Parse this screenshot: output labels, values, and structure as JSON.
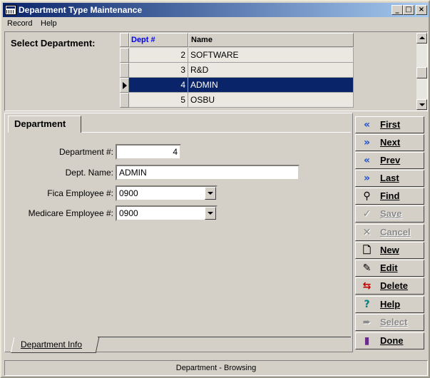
{
  "window": {
    "title": "Department Type Maintenance"
  },
  "menu": {
    "items": [
      "Record",
      "Help"
    ]
  },
  "select_label": "Select Department:",
  "grid": {
    "columns": [
      "Dept #",
      "Name"
    ],
    "rows": [
      {
        "num": "2",
        "name": "SOFTWARE"
      },
      {
        "num": "3",
        "name": "R&D"
      },
      {
        "num": "4",
        "name": "ADMIN"
      },
      {
        "num": "5",
        "name": "OSBU"
      }
    ],
    "selected_index": 2
  },
  "tab": {
    "title": "Department",
    "bottom_tab": "Department Info"
  },
  "form": {
    "dept_num_label": "Department #:",
    "dept_num_value": "4",
    "dept_name_label": "Dept. Name:",
    "dept_name_value": "ADMIN",
    "fica_label": "Fica Employee #:",
    "fica_value": "0900",
    "medicare_label": "Medicare Employee #:",
    "medicare_value": "0900"
  },
  "buttons": [
    {
      "label": "First",
      "icon": "first-icon",
      "enabled": true
    },
    {
      "label": "Next",
      "icon": "next-icon",
      "enabled": true
    },
    {
      "label": "Prev",
      "icon": "prev-icon",
      "enabled": true
    },
    {
      "label": "Last",
      "icon": "last-icon",
      "enabled": true
    },
    {
      "label": "Find",
      "icon": "magnifier-icon",
      "enabled": true
    },
    {
      "label": "Save",
      "icon": "check-icon",
      "enabled": false
    },
    {
      "label": "Cancel",
      "icon": "x-icon",
      "enabled": false
    },
    {
      "label": "New",
      "icon": "new-document-icon",
      "enabled": true
    },
    {
      "label": "Edit",
      "icon": "edit-icon",
      "enabled": true
    },
    {
      "label": "Delete",
      "icon": "delete-icon",
      "enabled": true
    },
    {
      "label": "Help",
      "icon": "question-icon",
      "enabled": true
    },
    {
      "label": "Select",
      "icon": "select-icon",
      "enabled": false
    },
    {
      "label": "Done",
      "icon": "door-icon",
      "enabled": true
    }
  ],
  "status": "Department - Browsing"
}
